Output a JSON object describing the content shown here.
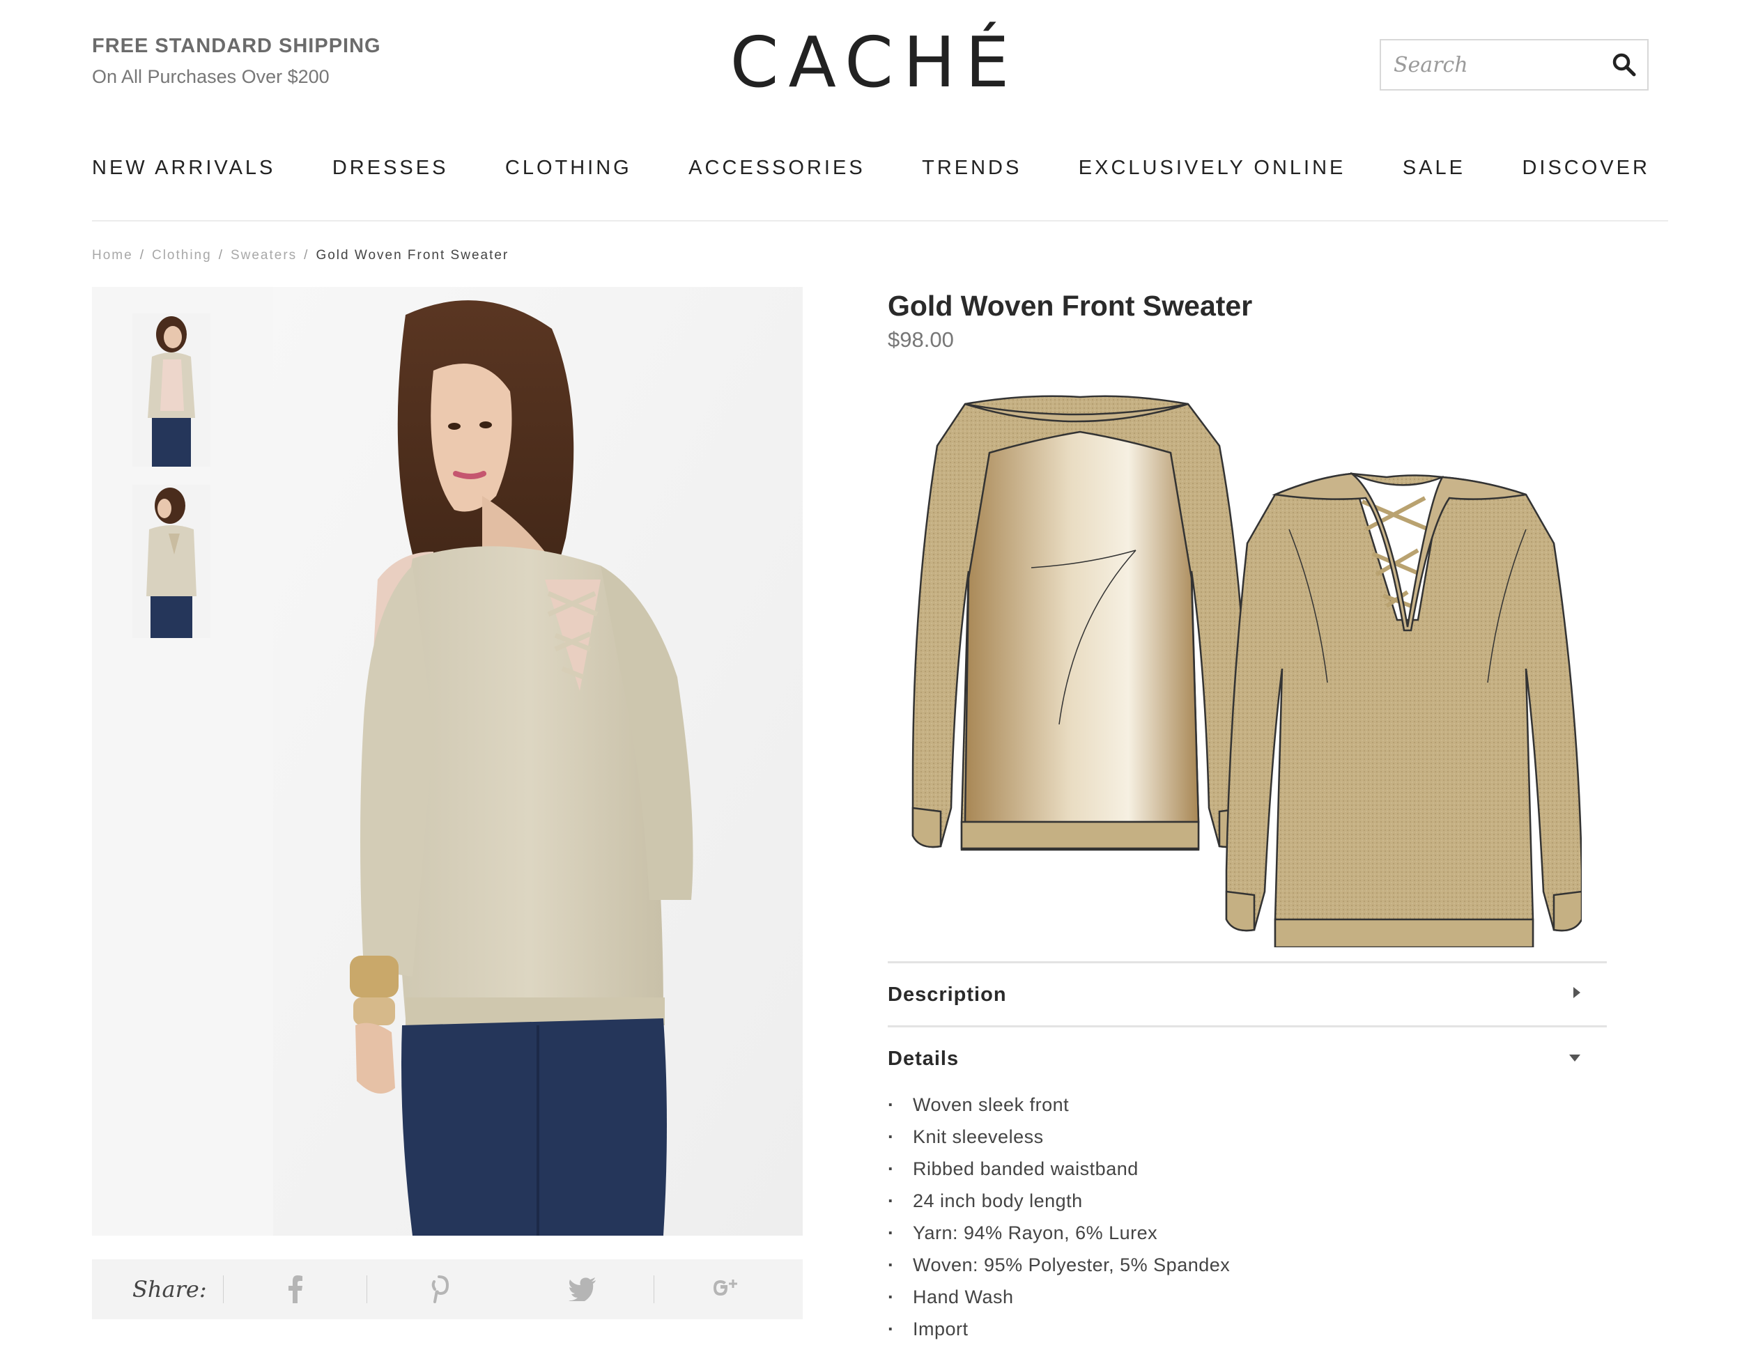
{
  "promo": {
    "title": "FREE STANDARD SHIPPING",
    "subtitle": "On All Purchases Over $200"
  },
  "brand": {
    "logo": "CACHÉ"
  },
  "search": {
    "placeholder": "Search",
    "icon": "search-icon"
  },
  "nav": {
    "items": [
      {
        "label": "NEW ARRIVALS"
      },
      {
        "label": "DRESSES"
      },
      {
        "label": "CLOTHING"
      },
      {
        "label": "ACCESSORIES"
      },
      {
        "label": "TRENDS"
      },
      {
        "label": "EXCLUSIVELY ONLINE"
      },
      {
        "label": "SALE"
      },
      {
        "label": "DISCOVER"
      }
    ]
  },
  "breadcrumb": {
    "items": [
      "Home",
      "Clothing",
      "Sweaters"
    ],
    "current": "Gold Woven Front Sweater",
    "separator": "/"
  },
  "product": {
    "title": "Gold Woven Front Sweater",
    "price": "$98.00"
  },
  "share": {
    "label": "Share:",
    "icons": {
      "facebook": "f",
      "pinterest": "P",
      "twitter": "twitter-bird",
      "googleplus": "g+"
    }
  },
  "accordion": {
    "description": {
      "title": "Description",
      "state": "collapsed"
    },
    "details": {
      "title": "Details",
      "state": "expanded",
      "items": [
        "Woven sleek front",
        "Knit sleeveless",
        "Ribbed banded waistband",
        "24 inch body length",
        "Yarn: 94% Rayon, 6% Lurex",
        "Woven: 95% Polyester, 5% Spandex",
        "Hand Wash",
        "Import"
      ]
    }
  },
  "colors": {
    "sweater_gold": "#c8b48a",
    "sweater_light": "#d9d2bf",
    "jeans": "#25365a",
    "hair": "#4a2c1c"
  }
}
